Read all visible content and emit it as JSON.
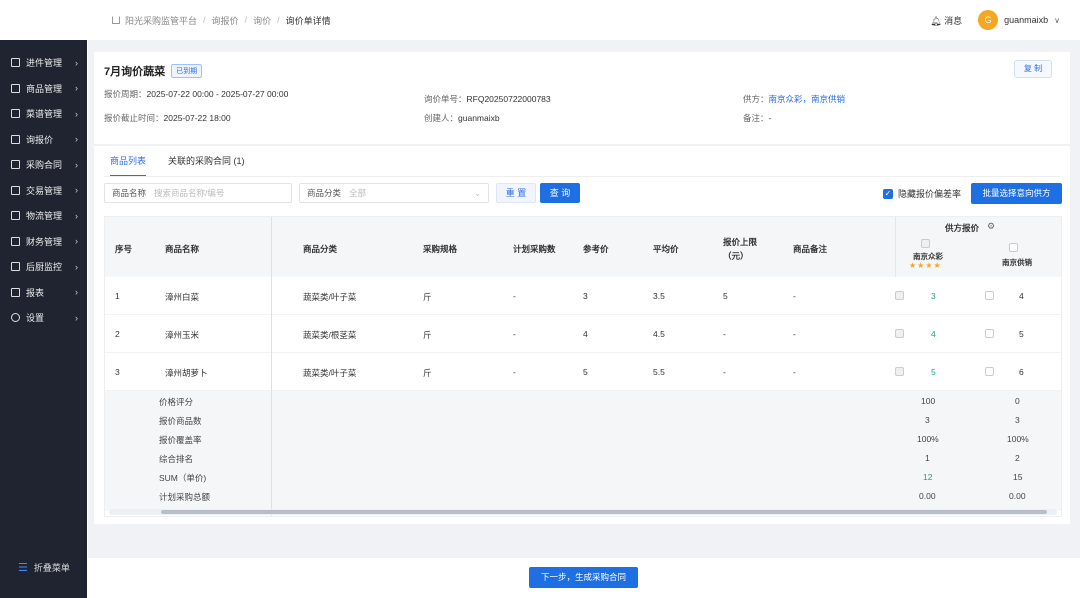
{
  "breadcrumb": {
    "items": [
      "阳光采购监管平台",
      "询报价",
      "询价",
      "询价单详情"
    ]
  },
  "header": {
    "messages": "消息",
    "avatar_letter": "G",
    "username": "guanmaixb"
  },
  "sidebar": {
    "items": [
      {
        "label": "进件管理"
      },
      {
        "label": "商品管理"
      },
      {
        "label": "菜谱管理"
      },
      {
        "label": "询报价"
      },
      {
        "label": "采购合同"
      },
      {
        "label": "交易管理"
      },
      {
        "label": "物流管理"
      },
      {
        "label": "财务管理"
      },
      {
        "label": "后厨监控"
      },
      {
        "label": "报表"
      },
      {
        "label": "设置"
      }
    ],
    "collapse": "折叠菜单"
  },
  "inquiry": {
    "title": "7月询价蔬菜",
    "status": "已到期",
    "copy": "复 制",
    "period_label": "报价周期：",
    "period": "2025-07-22 00:00 - 2025-07-27 00:00",
    "number_label": "询价单号：",
    "number": "RFQ20250722000783",
    "supplier_label": "供方：",
    "supplier1": "南京众彩",
    "supplier_sep": "，",
    "supplier2": "南京供销",
    "deadline_label": "报价截止时间：",
    "deadline": "2025-07-22 18:00",
    "creator_label": "创建人：",
    "creator": "guanmaixb",
    "remark_label": "备注：",
    "remark": "-"
  },
  "tabs": [
    "商品列表",
    "关联的采购合同 (1)"
  ],
  "filters": {
    "name_label": "商品名称",
    "name_placeholder": "搜索商品名称/编号",
    "category_label": "商品分类",
    "category_placeholder": "全部",
    "reset": "重 置",
    "query": "查 询",
    "hide_deviation": "隐藏报价偏差率",
    "batch": "批量选择意向供方"
  },
  "table": {
    "headers": [
      "序号",
      "商品名称",
      "商品分类",
      "采购规格",
      "计划采购数",
      "参考价",
      "平均价",
      "报价上限",
      "（元）",
      "商品备注"
    ],
    "supplier_header": "供方报价",
    "suppliers": [
      {
        "name": "南京众彩",
        "stars": "★★★★"
      },
      {
        "name": "南京供销"
      }
    ],
    "rows": [
      {
        "idx": "1",
        "name": "漳州白菜",
        "category": "蔬菜类/叶子菜",
        "spec": "斤",
        "plan": "-",
        "ref": "3",
        "avg": "3.5",
        "cap": "5",
        "note": "-",
        "s1": "3",
        "s2": "4"
      },
      {
        "idx": "2",
        "name": "漳州玉米",
        "category": "蔬菜类/根茎菜",
        "spec": "斤",
        "plan": "-",
        "ref": "4",
        "avg": "4.5",
        "cap": "-",
        "note": "-",
        "s1": "4",
        "s2": "5"
      },
      {
        "idx": "3",
        "name": "漳州胡萝卜",
        "category": "蔬菜类/叶子菜",
        "spec": "斤",
        "plan": "-",
        "ref": "5",
        "avg": "5.5",
        "cap": "-",
        "note": "-",
        "s1": "5",
        "s2": "6"
      }
    ],
    "summary": [
      {
        "label": "价格评分",
        "s1": "100",
        "s2": "0"
      },
      {
        "label": "报价商品数",
        "s1": "3",
        "s2": "3"
      },
      {
        "label": "报价覆盖率",
        "s1": "100%",
        "s2": "100%"
      },
      {
        "label": "综合排名",
        "s1": "1",
        "s2": "2"
      },
      {
        "label": "SUM（单价)",
        "s1": "12",
        "s2": "15"
      },
      {
        "label": "计划采购总额",
        "s1": "0.00",
        "s2": "0.00"
      }
    ]
  },
  "footer": {
    "next": "下一步，生成采购合同"
  }
}
